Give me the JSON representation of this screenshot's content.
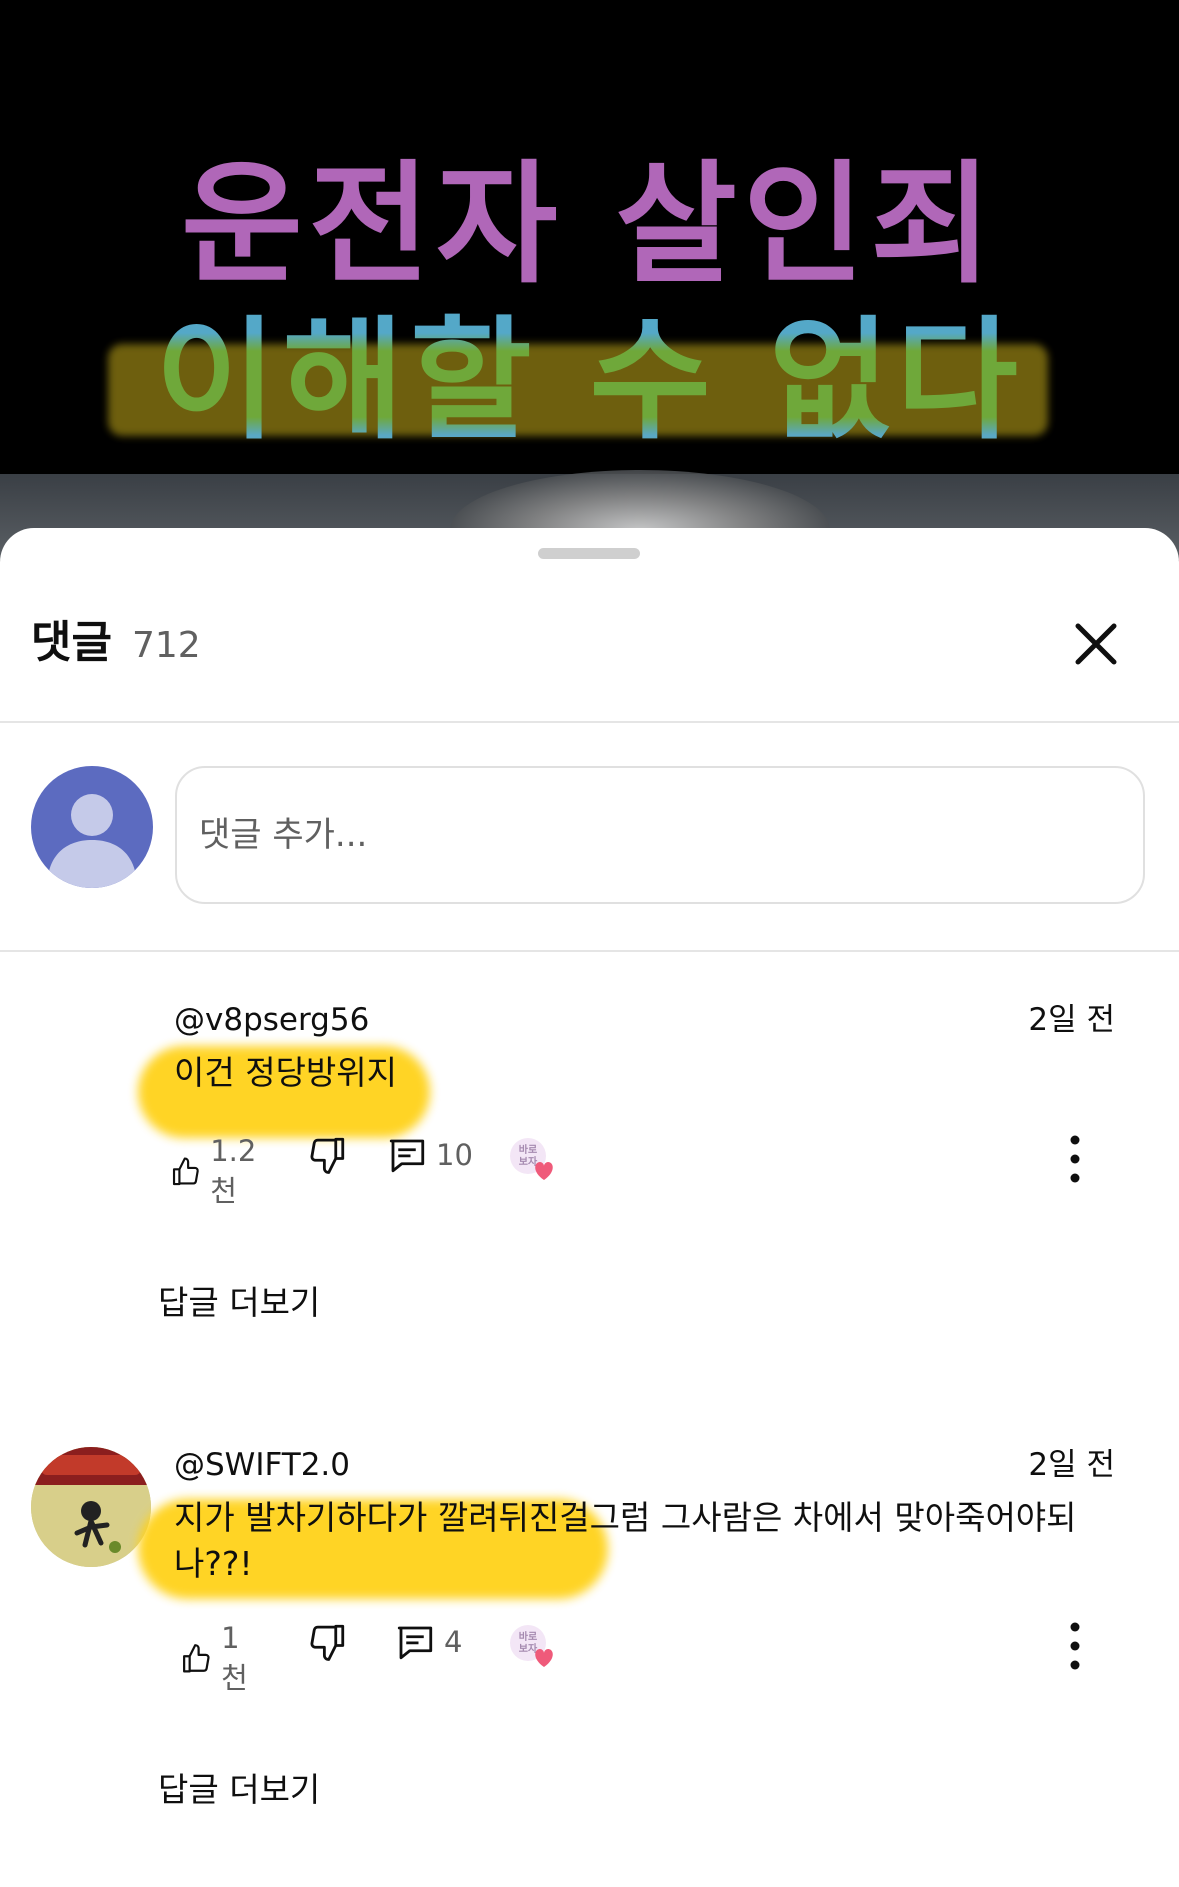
{
  "video": {
    "title_line1": "운전자 살인죄",
    "title_line2": "이해할 수 없다"
  },
  "comments_panel": {
    "title": "댓글",
    "count": "712",
    "input_placeholder": "댓글 추가..."
  },
  "comments": [
    {
      "author": "@v8pserg56",
      "time": "2일 전",
      "text": "이건 정당방위지",
      "likes": "1.2천",
      "replies_count": "10",
      "badge_text": "바로\n보자",
      "view_replies": "답글 더보기"
    },
    {
      "author": "@SWIFT2.0",
      "time": "2일 전",
      "text": "지가 발차기하다가 깔려뒤진걸그럼 그사람은 차에서 맞아죽어야되나??!",
      "likes": "1천",
      "replies_count": "4",
      "badge_text": "바로\n보자",
      "view_replies": "답글 더보기"
    }
  ],
  "colors": {
    "title_purple": "#b067b8",
    "title_green": "#6fa83a",
    "highlight": "#ffd21a",
    "avatar_blue": "#5c6bc0"
  }
}
